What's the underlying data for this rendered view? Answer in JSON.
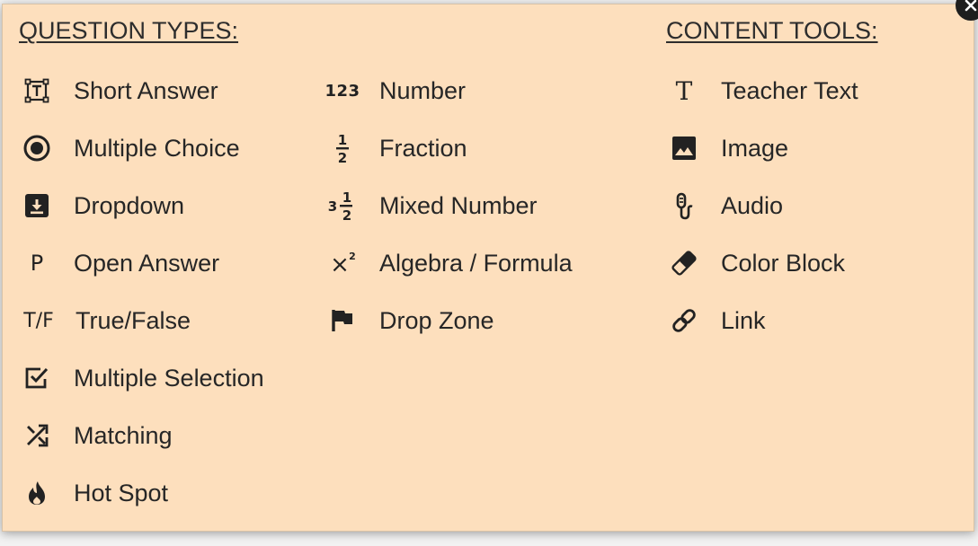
{
  "question_types": {
    "heading": "QUESTION TYPES:",
    "col1": [
      {
        "label": "Short Answer",
        "icon": "text-box-icon"
      },
      {
        "label": "Multiple Choice",
        "icon": "radio-button-icon"
      },
      {
        "label": "Dropdown",
        "icon": "dropdown-box-icon"
      },
      {
        "label": "Open Answer",
        "icon": "p-letter-icon",
        "glyph": "P"
      },
      {
        "label": "True/False",
        "icon": "true-false-icon",
        "glyph": "T/F"
      },
      {
        "label": "Multiple Selection",
        "icon": "checkbox-checked-icon"
      },
      {
        "label": "Matching",
        "icon": "shuffle-icon"
      },
      {
        "label": "Hot Spot",
        "icon": "fire-icon"
      }
    ],
    "col2": [
      {
        "label": "Number",
        "icon": "numbers-icon",
        "glyph": "123"
      },
      {
        "label": "Fraction",
        "icon": "fraction-icon",
        "num": "1",
        "den": "2"
      },
      {
        "label": "Mixed Number",
        "icon": "mixed-number-icon",
        "whole": "3",
        "num": "1",
        "den": "2"
      },
      {
        "label": "Algebra / Formula",
        "icon": "exponent-icon",
        "base": "×",
        "exp": "2"
      },
      {
        "label": "Drop Zone",
        "icon": "flag-icon"
      }
    ]
  },
  "content_tools": {
    "heading": "CONTENT TOOLS:",
    "items": [
      {
        "label": "Teacher Text",
        "icon": "serif-t-icon",
        "glyph": "T"
      },
      {
        "label": "Image",
        "icon": "image-icon"
      },
      {
        "label": "Audio",
        "icon": "microphone-icon"
      },
      {
        "label": "Color Block",
        "icon": "eraser-icon"
      },
      {
        "label": "Link",
        "icon": "link-icon"
      }
    ]
  },
  "close": {
    "icon": "close-icon"
  },
  "colors": {
    "panel_bg": "#fddfbd",
    "text": "#262626",
    "close_bg": "#1e1e1e"
  }
}
